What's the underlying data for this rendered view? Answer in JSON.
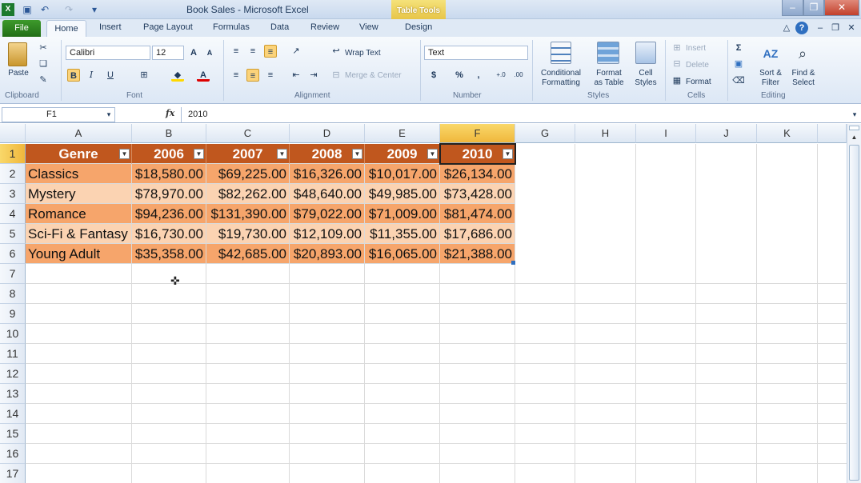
{
  "window": {
    "title": "Book Sales - Microsoft Excel",
    "context_tab": "Table Tools"
  },
  "tabs": [
    "File",
    "Home",
    "Insert",
    "Page Layout",
    "Formulas",
    "Data",
    "Review",
    "View",
    "Design"
  ],
  "ribbon": {
    "clipboard": {
      "paste": "Paste",
      "label": "Clipboard"
    },
    "font": {
      "name": "Calibri",
      "size": "12",
      "label": "Font"
    },
    "alignment": {
      "wrap": "Wrap Text",
      "merge": "Merge & Center",
      "label": "Alignment"
    },
    "number": {
      "format": "Text",
      "label": "Number"
    },
    "styles": {
      "cond": "Conditional Formatting",
      "cond1": "Conditional",
      "cond2": "Formatting",
      "astable1": "Format",
      "astable2": "as Table",
      "cell1": "Cell",
      "cell2": "Styles",
      "label": "Styles"
    },
    "cells": {
      "insert": "Insert",
      "delete": "Delete",
      "format": "Format",
      "label": "Cells"
    },
    "editing": {
      "sort1": "Sort &",
      "sort2": "Filter",
      "find1": "Find &",
      "find2": "Select",
      "label": "Editing"
    }
  },
  "formula_bar": {
    "name_box": "F1",
    "fx": "fx",
    "value": "2010"
  },
  "columns": [
    "A",
    "B",
    "C",
    "D",
    "E",
    "F",
    "G",
    "H",
    "I",
    "J",
    "K"
  ],
  "rows": [
    "1",
    "2",
    "3",
    "4",
    "5",
    "6",
    "7",
    "8",
    "9",
    "10",
    "11",
    "12",
    "13",
    "14",
    "15",
    "16",
    "17"
  ],
  "table": {
    "headers": [
      "Genre",
      "2006",
      "2007",
      "2008",
      "2009",
      "2010"
    ],
    "data": [
      [
        "Classics",
        "$18,580.00",
        "$69,225.00",
        "$16,326.00",
        "$10,017.00",
        "$26,134.00"
      ],
      [
        "Mystery",
        "$78,970.00",
        "$82,262.00",
        "$48,640.00",
        "$49,985.00",
        "$73,428.00"
      ],
      [
        "Romance",
        "$94,236.00",
        "$131,390.00",
        "$79,022.00",
        "$71,009.00",
        "$81,474.00"
      ],
      [
        "Sci-Fi & Fantasy",
        "$16,730.00",
        "$19,730.00",
        "$12,109.00",
        "$11,355.00",
        "$17,686.00"
      ],
      [
        "Young Adult",
        "$35,358.00",
        "$42,685.00",
        "$20,893.00",
        "$16,065.00",
        "$21,388.00"
      ]
    ]
  },
  "colors": {
    "header": "#c0571e",
    "band_dark": "#f6a56b",
    "band_light": "#fbd3b2",
    "file_tab": "#2e8a22"
  }
}
